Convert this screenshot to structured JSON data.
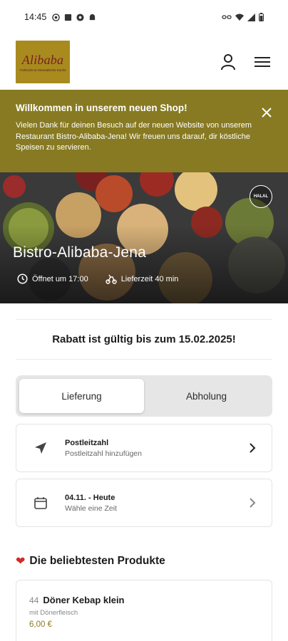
{
  "status_bar": {
    "time": "14:45"
  },
  "header": {
    "logo_text": "Alibaba",
    "logo_subtext": "Türkische & Orientalische Küche"
  },
  "welcome": {
    "title": "Willkommen in unserem neuen Shop!",
    "text": "Vielen Dank für deinen Besuch auf der neuen Website von unserem Restaurant Bistro-Alibaba-Jena! Wir freuen uns darauf, dir köstliche Speisen zu servieren."
  },
  "hero": {
    "restaurant_name": "Bistro-Alibaba-Jena",
    "opening": "Öffnet um 17:00",
    "delivery_time": "Lieferzeit 40 min",
    "badge": "HALAL"
  },
  "discount": {
    "text": "Rabatt ist gültig bis zum 15.02.2025!"
  },
  "order_mode": {
    "tabs": [
      {
        "label": "Lieferung",
        "active": true
      },
      {
        "label": "Abholung",
        "active": false
      }
    ]
  },
  "postcode": {
    "title": "Postleitzahl",
    "subtitle": "Postleitzahl hinzufügen"
  },
  "time": {
    "title": "04.11. - Heute",
    "subtitle": "Wähle eine Zeit"
  },
  "popular": {
    "title": "Die beliebtesten Produkte",
    "products": [
      {
        "number": "44",
        "name": "Döner Kebap klein",
        "description": "mit Dönerfleisch",
        "price": "6,00 €"
      }
    ]
  },
  "colors": {
    "accent": "#877a22",
    "price": "#8b7a22",
    "heart": "#d62828"
  }
}
